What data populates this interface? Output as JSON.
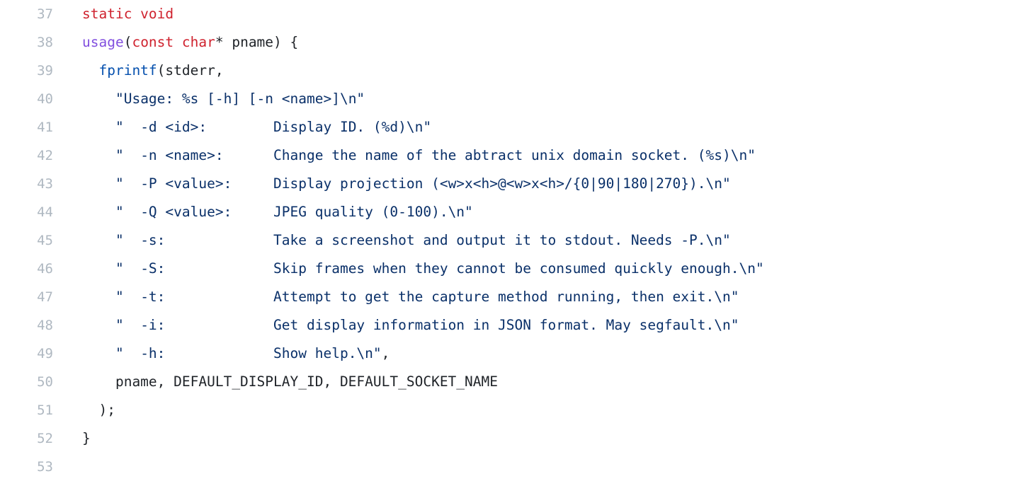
{
  "editor": {
    "language": "c",
    "theme": "github-light",
    "background_color": "#ffffff",
    "line_number_color": "#afb8c1",
    "plain_text_color": "#1f2328",
    "colors": {
      "keyword": "#cf222e",
      "function": "#8250df",
      "builtin": "#0550ae",
      "string": "#0a3069",
      "plain": "#1f2328"
    },
    "first_line": 37,
    "last_line": 53
  },
  "lines": [
    {
      "number": "37",
      "text": "static void",
      "tokens": [
        {
          "t": "static void",
          "c": "tok-kw"
        }
      ]
    },
    {
      "number": "38",
      "text": "usage(const char* pname) {",
      "tokens": [
        {
          "t": "usage",
          "c": "tok-fn"
        },
        {
          "t": "(",
          "c": "tok-pl"
        },
        {
          "t": "const char",
          "c": "tok-kw"
        },
        {
          "t": "* pname) {",
          "c": "tok-pl"
        }
      ]
    },
    {
      "number": "39",
      "text": "  fprintf(stderr,",
      "tokens": [
        {
          "t": "  ",
          "c": "tok-pl"
        },
        {
          "t": "fprintf",
          "c": "tok-bi"
        },
        {
          "t": "(stderr,",
          "c": "tok-pl"
        }
      ]
    },
    {
      "number": "40",
      "text": "    \"Usage: %s [-h] [-n <name>]\\n\"",
      "tokens": [
        {
          "t": "    ",
          "c": "tok-pl"
        },
        {
          "t": "\"Usage: %s [-h] [-n <name>]\\n\"",
          "c": "tok-str"
        }
      ]
    },
    {
      "number": "41",
      "text": "    \"  -d <id>:        Display ID. (%d)\\n\"",
      "tokens": [
        {
          "t": "    ",
          "c": "tok-pl"
        },
        {
          "t": "\"  -d <id>:        Display ID. (%d)\\n\"",
          "c": "tok-str"
        }
      ]
    },
    {
      "number": "42",
      "text": "    \"  -n <name>:      Change the name of the abtract unix domain socket. (%s)\\n\"",
      "tokens": [
        {
          "t": "    ",
          "c": "tok-pl"
        },
        {
          "t": "\"  -n <name>:      Change the name of the abtract unix domain socket. (%s)\\n\"",
          "c": "tok-str"
        }
      ]
    },
    {
      "number": "43",
      "text": "    \"  -P <value>:     Display projection (<w>x<h>@<w>x<h>/{0|90|180|270}).\\n\"",
      "tokens": [
        {
          "t": "    ",
          "c": "tok-pl"
        },
        {
          "t": "\"  -P <value>:     Display projection (<w>x<h>@<w>x<h>/{0|90|180|270}).\\n\"",
          "c": "tok-str"
        }
      ]
    },
    {
      "number": "44",
      "text": "    \"  -Q <value>:     JPEG quality (0-100).\\n\"",
      "tokens": [
        {
          "t": "    ",
          "c": "tok-pl"
        },
        {
          "t": "\"  -Q <value>:     JPEG quality (0-100).\\n\"",
          "c": "tok-str"
        }
      ]
    },
    {
      "number": "45",
      "text": "    \"  -s:             Take a screenshot and output it to stdout. Needs -P.\\n\"",
      "tokens": [
        {
          "t": "    ",
          "c": "tok-pl"
        },
        {
          "t": "\"  -s:             Take a screenshot and output it to stdout. Needs -P.\\n\"",
          "c": "tok-str"
        }
      ]
    },
    {
      "number": "46",
      "text": "    \"  -S:             Skip frames when they cannot be consumed quickly enough.\\n\"",
      "tokens": [
        {
          "t": "    ",
          "c": "tok-pl"
        },
        {
          "t": "\"  -S:             Skip frames when they cannot be consumed quickly enough.\\n\"",
          "c": "tok-str"
        }
      ]
    },
    {
      "number": "47",
      "text": "    \"  -t:             Attempt to get the capture method running, then exit.\\n\"",
      "tokens": [
        {
          "t": "    ",
          "c": "tok-pl"
        },
        {
          "t": "\"  -t:             Attempt to get the capture method running, then exit.\\n\"",
          "c": "tok-str"
        }
      ]
    },
    {
      "number": "48",
      "text": "    \"  -i:             Get display information in JSON format. May segfault.\\n\"",
      "tokens": [
        {
          "t": "    ",
          "c": "tok-pl"
        },
        {
          "t": "\"  -i:             Get display information in JSON format. May segfault.\\n\"",
          "c": "tok-str"
        }
      ]
    },
    {
      "number": "49",
      "text": "    \"  -h:             Show help.\\n\",",
      "tokens": [
        {
          "t": "    ",
          "c": "tok-pl"
        },
        {
          "t": "\"  -h:             Show help.\\n\"",
          "c": "tok-str"
        },
        {
          "t": ",",
          "c": "tok-pl"
        }
      ]
    },
    {
      "number": "50",
      "text": "    pname, DEFAULT_DISPLAY_ID, DEFAULT_SOCKET_NAME",
      "tokens": [
        {
          "t": "    pname, DEFAULT_DISPLAY_ID, DEFAULT_SOCKET_NAME",
          "c": "tok-pl"
        }
      ]
    },
    {
      "number": "51",
      "text": "  );",
      "tokens": [
        {
          "t": "  );",
          "c": "tok-pl"
        }
      ]
    },
    {
      "number": "52",
      "text": "}",
      "tokens": [
        {
          "t": "}",
          "c": "tok-pl"
        }
      ]
    },
    {
      "number": "53",
      "text": "",
      "tokens": []
    }
  ]
}
